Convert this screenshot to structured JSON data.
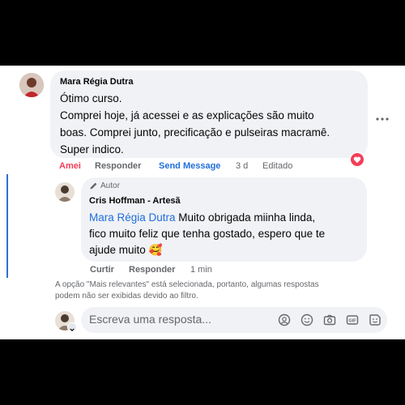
{
  "comment": {
    "author": "Mara Régia Dutra",
    "text_lines": [
      "Ótimo curso.",
      "Comprei hoje, já acessei e as explicações são muito",
      "boas. Comprei junto, precificação e pulseiras macramê.",
      "Super indico."
    ],
    "actions": {
      "reaction": "Amei",
      "reply": "Responder",
      "send_message": "Send Message",
      "time": "3 d",
      "edited": "Editado"
    },
    "reaction_color": "#f33e58"
  },
  "reply": {
    "badge": "Autor",
    "author": "Cris Hoffman - Artesã",
    "mention": "Mara Régia Dutra",
    "text_line1": " Muito obrigada miinha linda,",
    "text_line2": "fico muito feliz que tenha gostado, espero que te",
    "text_line3": "ajude muito ",
    "emoji": "🥰",
    "actions": {
      "like": "Curtir",
      "reply": "Responder",
      "time": "1 min"
    }
  },
  "notice": {
    "line1": "A opção \"Mais relevantes\" está selecionada, portanto, algumas respostas",
    "line2": "podem não ser exibidas devido ao filtro."
  },
  "composer": {
    "placeholder": "Escreva uma resposta..."
  },
  "colors": {
    "accent_blue": "#216fdb",
    "mention_blue": "#216fdb",
    "text_gray": "#65676b"
  }
}
